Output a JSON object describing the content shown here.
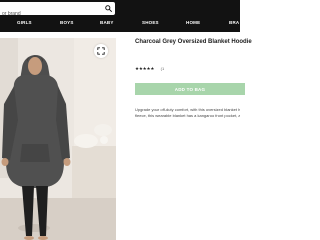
{
  "search": {
    "placeholder": "or brand"
  },
  "nav": {
    "items": [
      "GIRLS",
      "BOYS",
      "BABY",
      "SHOES",
      "HOME",
      "BRA"
    ]
  },
  "product": {
    "title": "Charcoal Grey Oversized Blanket Hoodie",
    "rating_stars": "★★★★★",
    "rating_count": "(1",
    "add_to_bag": "ADD TO BAG",
    "description_lines": [
      "Upgrade your off-duty comfort, with this oversized blanket h",
      "fleece, this wearable blanket has a kangaroo front pocket, a s"
    ]
  },
  "colors": {
    "topbar": "#121212",
    "add_to_bag": "#a8d5ab",
    "image_bg": "#ece7e1"
  }
}
